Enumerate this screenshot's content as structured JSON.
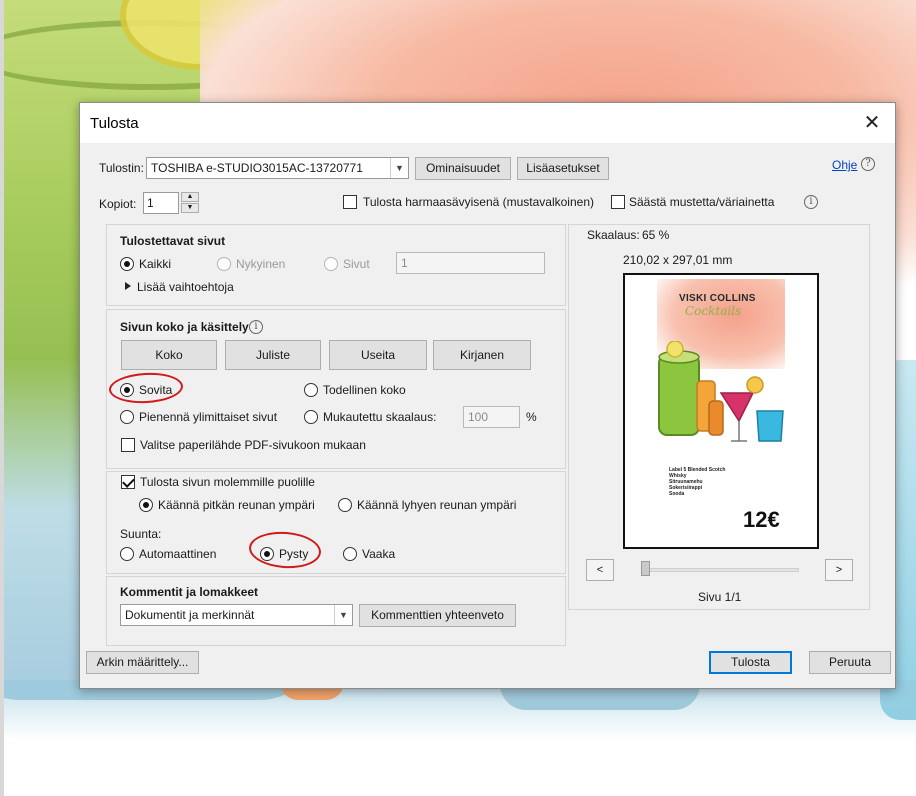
{
  "dialog": {
    "title": "Tulosta",
    "close_glyph": "✕"
  },
  "printer": {
    "label": "Tulostin:",
    "selected": "TOSHIBA e-STUDIO3015AC-13720771",
    "properties_button": "Ominaisuudet",
    "advanced_button": "Lisäasetukset",
    "help_link": "Ohje",
    "help_icon": "question-icon",
    "copies_label": "Kopiot:",
    "copies_value": "1",
    "grayscale_label": "Tulosta harmaasävyisenä (mustavalkoinen)",
    "grayscale_checked": false,
    "save_ink_label": "Säästä mustetta/väriainetta",
    "save_ink_checked": false
  },
  "pages_to_print": {
    "title": "Tulostettavat sivut",
    "options": [
      "Kaikki",
      "Nykyinen",
      "Sivut"
    ],
    "selected": "Kaikki",
    "pages_value": "1",
    "more_options": "Lisää vaihtoehtoja"
  },
  "size_handling": {
    "title": "Sivun koko ja käsittely",
    "tabs": [
      "Koko",
      "Juliste",
      "Useita",
      "Kirjanen"
    ],
    "fit_label": "Sovita",
    "actual_label": "Todellinen koko",
    "shrink_label": "Pienennä ylimittaiset sivut",
    "custom_label": "Mukautettu skaalaus:",
    "custom_value": "100",
    "percent": "%",
    "selected": "Sovita",
    "paper_source_label": "Valitse paperilähde PDF-sivukoon mukaan",
    "paper_source_checked": false
  },
  "duplex": {
    "label": "Tulosta sivun molemmille puolille",
    "checked": true,
    "long_edge": "Käännä pitkän reunan ympäri",
    "short_edge": "Käännä lyhyen reunan ympäri",
    "selected": "Käännä pitkän reunan ympäri"
  },
  "orientation": {
    "label": "Suunta:",
    "auto": "Automaattinen",
    "portrait": "Pysty",
    "landscape": "Vaaka",
    "selected": "Pysty"
  },
  "comments": {
    "title": "Kommentit ja lomakkeet",
    "selected": "Dokumentit ja merkinnät",
    "summary_button": "Kommenttien yhteenveto"
  },
  "preview": {
    "scale_label": "Skaalaus:",
    "scale_value": "65 %",
    "dimensions": "210,02 x 297,01 mm",
    "prev_glyph": "<",
    "next_glyph": ">",
    "page_label": "Sivu 1/1",
    "page_progress": 0.0,
    "doc": {
      "title_line1": "VISKI COLLINS",
      "title_line2": "Cocktails",
      "ingredients": [
        "Label 5 Blended Scotch",
        "Whisky",
        "Sitruunamehu",
        "Sokerisiirappi",
        "Sooda"
      ],
      "price": "12€"
    }
  },
  "footer": {
    "page_setup_button": "Arkin määrittely...",
    "print_button": "Tulosta",
    "cancel_button": "Peruuta"
  },
  "colors": {
    "annotation_red": "#d11a1a",
    "primary_border": "#0078d7",
    "link": "#0044cc"
  }
}
